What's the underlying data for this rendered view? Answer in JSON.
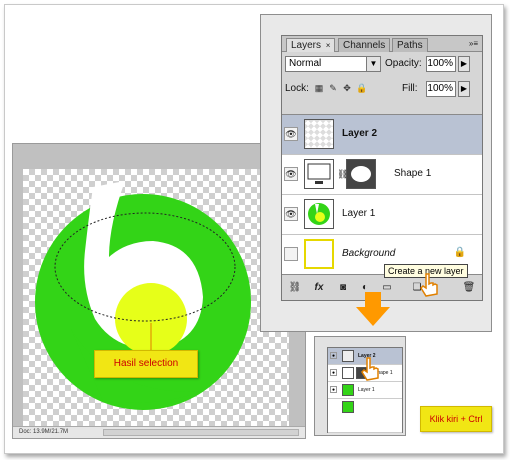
{
  "callouts": {
    "selection_result": "Hasil selection",
    "instruction": "Klik kiri + Ctrl"
  },
  "canvas": {
    "status_text": "Doc: 13.9M/21.7M"
  },
  "layers_panel": {
    "tabs": [
      {
        "label": "Layers",
        "close": "×"
      },
      {
        "label": "Channels"
      },
      {
        "label": "Paths"
      }
    ],
    "menu_icon": "»≡",
    "blend_mode": "Normal",
    "opacity_label": "Opacity:",
    "opacity_value": "100%",
    "lock_label": "Lock:",
    "fill_label": "Fill:",
    "fill_value": "100%",
    "layers": [
      {
        "name": "Layer 2",
        "visible": true,
        "selected": true
      },
      {
        "name": "Shape 1",
        "visible": true,
        "selected": false
      },
      {
        "name": "Layer 1",
        "visible": true,
        "selected": false
      },
      {
        "name": "Background",
        "visible": false,
        "selected": false,
        "locked": true
      }
    ],
    "tooltip": "Create a new layer",
    "bottom_icons": [
      "link-icon",
      "fx-icon",
      "mask-icon",
      "adjustment-icon",
      "group-icon",
      "new-layer-icon",
      "trash-icon"
    ]
  },
  "mini_panel": {
    "layers": [
      {
        "name": "Layer 2"
      },
      {
        "name": "Shape 1"
      },
      {
        "name": "Layer 1"
      }
    ]
  },
  "colors": {
    "green": "#33d417",
    "yellow": "#e6ff19",
    "callout": "#f1e614",
    "arrow": "#ff9900",
    "selected_row": "#b9c2d3"
  }
}
